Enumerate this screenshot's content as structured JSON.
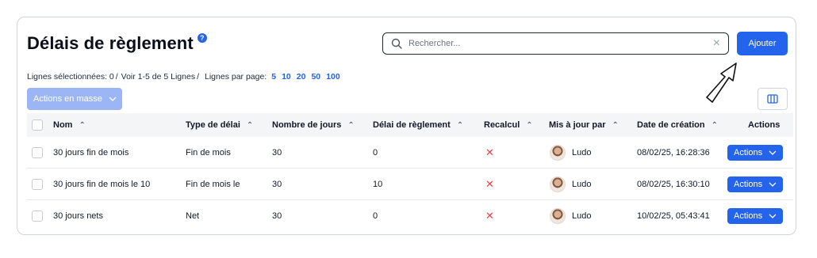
{
  "header": {
    "title": "Délais de règlement",
    "help_glyph": "?"
  },
  "search": {
    "placeholder": "Rechercher...",
    "value": ""
  },
  "add_button": {
    "label": "Ajouter"
  },
  "meta": {
    "selected": "Lignes sélectionnées: 0",
    "range": "Voir 1-5 de 5 Lignes",
    "per_page_label": "Lignes par page:",
    "page_sizes": [
      "5",
      "10",
      "20",
      "50",
      "100"
    ]
  },
  "bulk_actions": {
    "label": "Actions en masse"
  },
  "columns": [
    {
      "label": "Nom",
      "sort": "⌃"
    },
    {
      "label": "Type de délai",
      "sort": "⌃"
    },
    {
      "label": "Nombre de jours",
      "sort": "⌃"
    },
    {
      "label": "Délai de règlement",
      "sort": "⌃"
    },
    {
      "label": "Recalcul",
      "sort": "⌃"
    },
    {
      "label": "Mis à jour par",
      "sort": "⌃"
    },
    {
      "label": "Date de création",
      "sort": "⌃"
    },
    {
      "label": "Actions"
    }
  ],
  "rows": [
    {
      "nom": "30 jours fin de mois",
      "type": "Fin de mois",
      "jours": "30",
      "delai": "0",
      "recalcul": "✕",
      "user": "Ludo",
      "date": "08/02/25, 16:28:36",
      "action": "Actions"
    },
    {
      "nom": "30 jours fin de mois le 10",
      "type": "Fin de mois le",
      "jours": "30",
      "delai": "10",
      "recalcul": "✕",
      "user": "Ludo",
      "date": "08/02/25, 16:30:10",
      "action": "Actions"
    },
    {
      "nom": "30 jours nets",
      "type": "Net",
      "jours": "30",
      "delai": "0",
      "recalcul": "✕",
      "user": "Ludo",
      "date": "10/02/25, 05:43:41",
      "action": "Actions"
    }
  ],
  "colors": {
    "accent": "#2463eb",
    "bulk_disabled": "#9bb5f5",
    "cancel_red": "#e5484d",
    "header_bg": "#f4f5f7"
  },
  "icons": {
    "search": "search-icon",
    "clear": "close-icon",
    "columns": "columns-icon",
    "chevron": "chevron-down-icon",
    "recalcul": "x-mark-icon"
  }
}
